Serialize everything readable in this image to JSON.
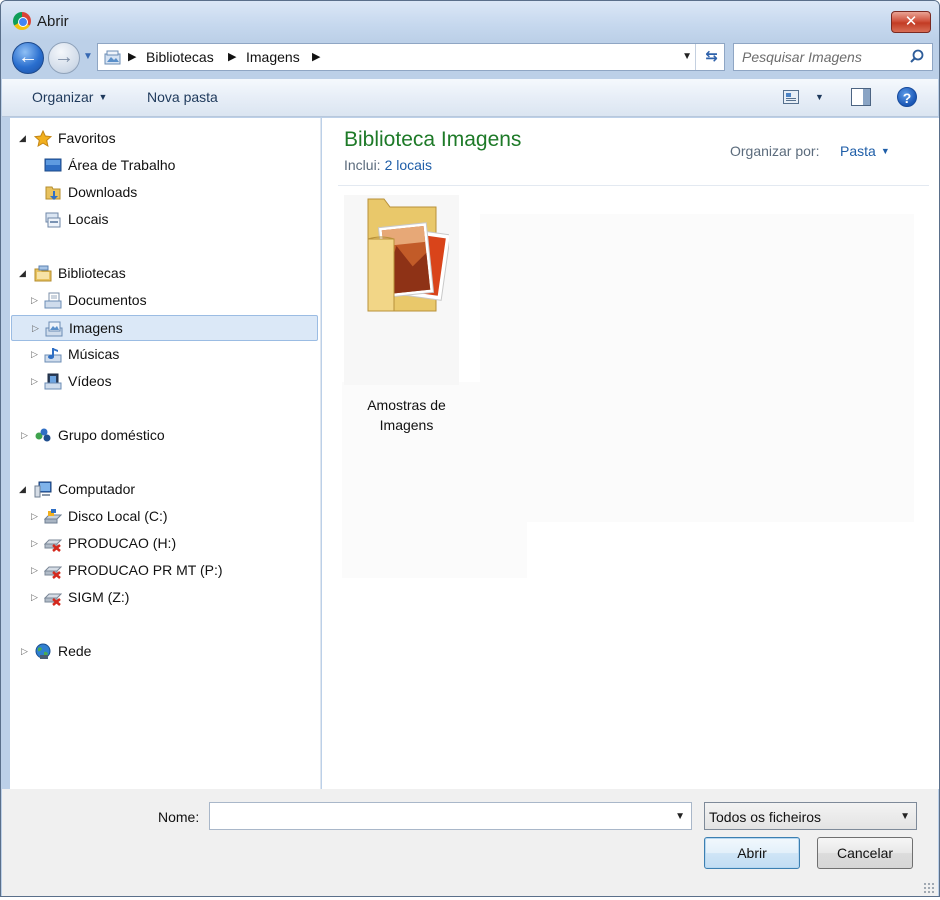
{
  "window": {
    "title": "Abrir"
  },
  "address": {
    "crumbs": [
      "Bibliotecas",
      "Imagens"
    ]
  },
  "search": {
    "placeholder": "Pesquisar Imagens"
  },
  "toolbar": {
    "organize_label": "Organizar",
    "new_folder_label": "Nova pasta"
  },
  "sidebar": {
    "favorites": {
      "label": "Favoritos",
      "items": [
        "Área de Trabalho",
        "Downloads",
        "Locais"
      ]
    },
    "libraries": {
      "label": "Bibliotecas",
      "items": [
        "Documentos",
        "Imagens",
        "Músicas",
        "Vídeos"
      ],
      "selected": "Imagens"
    },
    "homegroup": {
      "label": "Grupo doméstico"
    },
    "computer": {
      "label": "Computador",
      "items": [
        "Disco Local (C:)",
        "PRODUCAO (H:)",
        "PRODUCAO PR MT (P:)",
        "SIGM (Z:)"
      ]
    },
    "network": {
      "label": "Rede"
    }
  },
  "content": {
    "title": "Biblioteca Imagens",
    "includes_label": "Inclui:",
    "includes_link": "2 locais",
    "arrange_label": "Organizar por:",
    "arrange_value": "Pasta",
    "items": [
      {
        "label_line1": "Amostras de",
        "label_line2": "Imagens",
        "icon": "sample-pictures-folder-icon"
      }
    ]
  },
  "footer": {
    "name_label": "Nome:",
    "name_value": "",
    "filter_value": "Todos os ficheiros",
    "open_label": "Abrir",
    "cancel_label": "Cancelar"
  },
  "colors": {
    "title_green": "#1e7a28",
    "link_blue": "#1f5ea8",
    "selection_bg": "#dbe8f7",
    "close_red": "#c23b24"
  }
}
